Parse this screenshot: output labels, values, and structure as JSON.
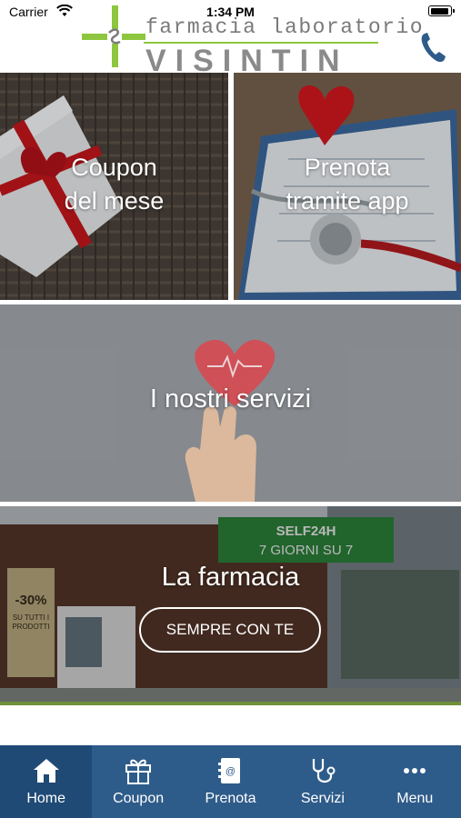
{
  "status_bar": {
    "carrier": "Carrier",
    "time": "1:34 PM"
  },
  "header": {
    "logo_line1": "farmacia laboratorio",
    "logo_line2": "VISINTIN",
    "phone_icon": "phone-icon",
    "accent_color": "#8ec63f",
    "phone_color": "#2e5c8a"
  },
  "tiles": {
    "coupon": {
      "label_line1": "Coupon",
      "label_line2": "del mese"
    },
    "prenota": {
      "label_line1": "Prenota",
      "label_line2": "tramite app"
    },
    "servizi": {
      "label": "I nostri servizi"
    },
    "farmacia": {
      "label": "La farmacia",
      "button": "SEMPRE CON TE",
      "sign_line1": "SELF24H",
      "sign_line2": "7 GIORNI SU 7",
      "poster_text1": "-30%",
      "poster_text2": "SU TUTTI I PRODOTTI"
    }
  },
  "tabbar": {
    "background": "#2e5c8a",
    "active_background": "#1f4a75",
    "items": [
      {
        "label": "Home",
        "icon": "home-icon",
        "active": true
      },
      {
        "label": "Coupon",
        "icon": "gift-icon",
        "active": false
      },
      {
        "label": "Prenota",
        "icon": "address-book-icon",
        "active": false
      },
      {
        "label": "Servizi",
        "icon": "stethoscope-icon",
        "active": false
      },
      {
        "label": "Menu",
        "icon": "more-icon",
        "active": false
      }
    ]
  }
}
